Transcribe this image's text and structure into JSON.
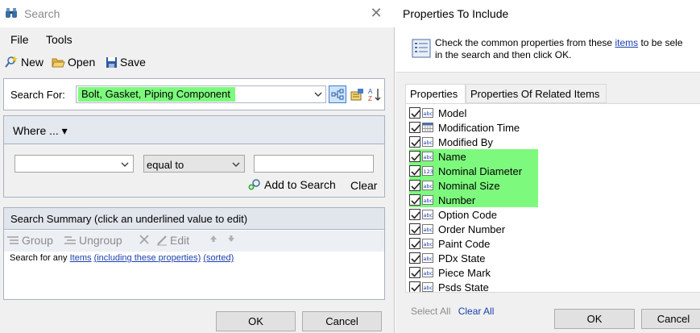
{
  "left_window": {
    "title": "Search",
    "menu": [
      "File",
      "Tools"
    ],
    "toolbar": {
      "new": "New",
      "open": "Open",
      "save": "Save"
    },
    "search_for": {
      "label": "Search For:",
      "value": "Bolt, Gasket, Piping Component"
    },
    "where": {
      "label": "Where ...",
      "property_value": "",
      "operator_value": "equal to",
      "criteria_value": "",
      "add_to_search": "Add to Search",
      "clear": "Clear"
    },
    "summary": {
      "header": "Search Summary (click an underlined value to edit)",
      "tools": {
        "group": "Group",
        "ungroup": "Ungroup",
        "edit": "Edit"
      },
      "text_prefix": "Search for any",
      "link_items": "Items",
      "link_including": "(including these properties)",
      "link_sorted": "(sorted)"
    },
    "buttons": {
      "ok": "OK",
      "cancel": "Cancel"
    }
  },
  "right_window": {
    "title": "Properties To Include",
    "message_line1_prefix": "Check the common properties from these",
    "message_link": "items",
    "message_line1_suffix": "to be sele",
    "message_line2": "in the search and then click OK.",
    "tabs": [
      "Properties",
      "Properties Of Related Items"
    ],
    "properties": [
      {
        "label": "Model",
        "icon": "abc",
        "checked": true,
        "highlight": false
      },
      {
        "label": "Modification Time",
        "icon": "calendar",
        "checked": true,
        "highlight": false
      },
      {
        "label": "Modified By",
        "icon": "abc",
        "checked": true,
        "highlight": false
      },
      {
        "label": "Name",
        "icon": "abc",
        "checked": true,
        "highlight": true
      },
      {
        "label": "Nominal Diameter",
        "icon": "123",
        "checked": true,
        "highlight": true
      },
      {
        "label": "Nominal Size",
        "icon": "abc",
        "checked": true,
        "highlight": true
      },
      {
        "label": "Number",
        "icon": "abc",
        "checked": true,
        "highlight": true
      },
      {
        "label": "Option Code",
        "icon": "abc",
        "checked": true,
        "highlight": false
      },
      {
        "label": "Order Number",
        "icon": "abc",
        "checked": true,
        "highlight": false
      },
      {
        "label": "Paint Code",
        "icon": "abc",
        "checked": true,
        "highlight": false
      },
      {
        "label": "PDx State",
        "icon": "abc",
        "checked": true,
        "highlight": false
      },
      {
        "label": "Piece Mark",
        "icon": "abc",
        "checked": true,
        "highlight": false
      },
      {
        "label": "Psds State",
        "icon": "abc",
        "checked": true,
        "highlight": false
      }
    ],
    "select_all": "Select All",
    "clear_all": "Clear All",
    "buttons": {
      "ok": "OK",
      "cancel": "Cancel"
    }
  },
  "colors": {
    "highlight": "#7dfa7d",
    "link": "#1a3fae"
  }
}
